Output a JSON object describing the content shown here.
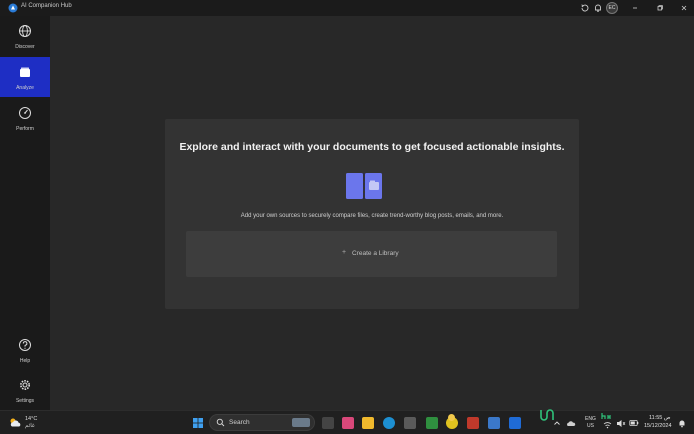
{
  "window": {
    "title": "AI Companion Hub",
    "avatar_initials": "EC"
  },
  "sidebar": {
    "items": [
      {
        "label": "Discover",
        "icon": "globe-icon"
      },
      {
        "label": "Analyze",
        "icon": "folder-icon",
        "active": true
      },
      {
        "label": "Perform",
        "icon": "gauge-icon"
      },
      {
        "label": "Help",
        "icon": "help-icon"
      },
      {
        "label": "Settings",
        "icon": "gear-icon"
      }
    ]
  },
  "main": {
    "heading": "Explore and interact with your documents to get focused actionable insights.",
    "description": "Add your own sources to securely compare files, create trend-worthy blog posts, emails, and more.",
    "create_button_plus": "+",
    "create_button_label": "Create a Library"
  },
  "taskbar": {
    "weather_temp": "14°C",
    "weather_condition": "غائم",
    "search_placeholder": "Search",
    "tray_lang_top": "ENG",
    "tray_lang_bottom": "US",
    "clock_time": "11:55 ص",
    "clock_date": "15/12/2024"
  },
  "colors": {
    "accent": "#1e2ec4",
    "doc_icon": "#6b76ec",
    "background": "#282828",
    "card": "#333333"
  }
}
